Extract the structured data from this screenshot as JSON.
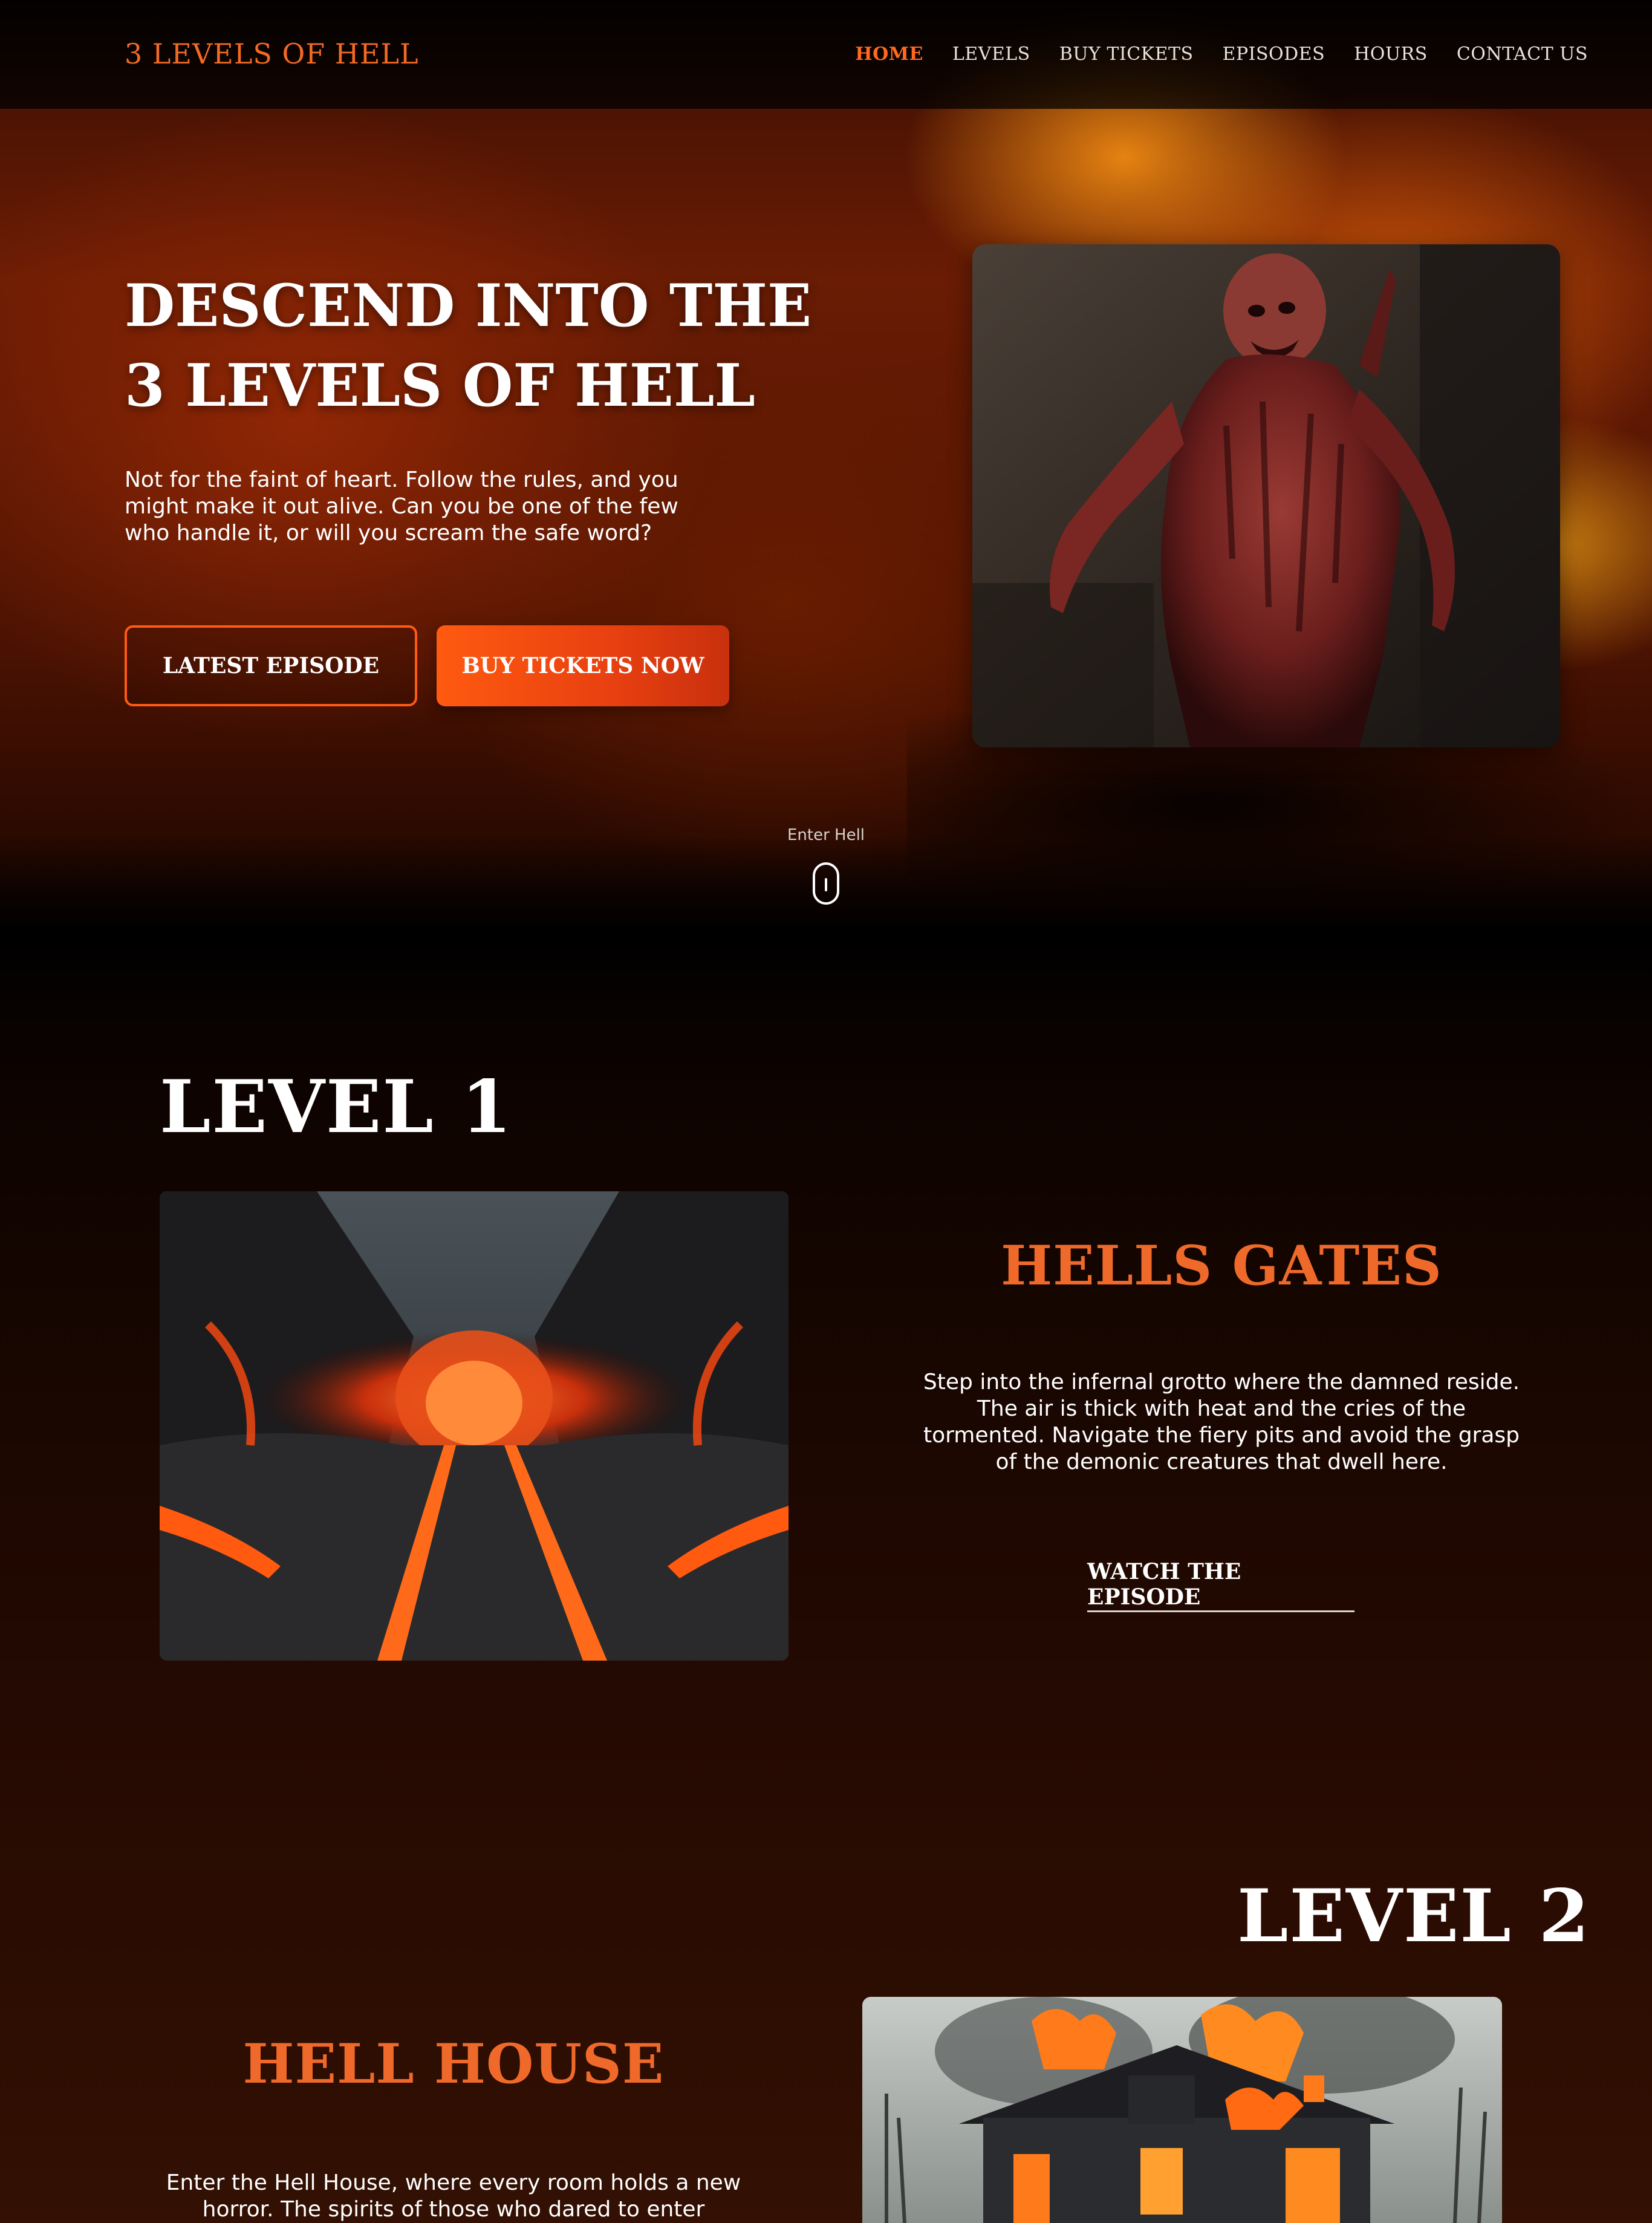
{
  "header": {
    "logo": "3 LEVELS OF HELL",
    "nav": [
      "HOME",
      "LEVELS",
      "BUY TICKETS",
      "EPISODES",
      "HOURS",
      "CONTACT US"
    ],
    "active_nav": "HOME"
  },
  "hero": {
    "title_line1": "DESCEND INTO THE",
    "title_line2": "3 LEVELS OF HELL",
    "subtitle": "Not for the faint of heart. Follow the rules, and you might make it out alive. Can you be one of the few who handle it, or will you scream the safe word?",
    "btn_latest": "LATEST EPISODE",
    "btn_tickets": "BUY TICKETS NOW",
    "scroll_label": "Enter Hell"
  },
  "level1": {
    "heading": "LEVEL 1",
    "title": "HELLS GATES",
    "description": "Step into the infernal grotto where the damned reside. The air is thick with heat and the cries of the tormented. Navigate the fiery pits and avoid the grasp of the demonic creatures that dwell here.",
    "button": "WATCH THE EPISODE"
  },
  "level2": {
    "heading": "LEVEL 2",
    "title": "HELL HOUSE",
    "description": "Enter the Hell House, where every room holds a new horror. The spirits of those who dared to enter"
  },
  "colors": {
    "accent": "#ff5a12",
    "logo": "#f26a24",
    "section_title": "#ef6a2a",
    "background": "#000000"
  }
}
